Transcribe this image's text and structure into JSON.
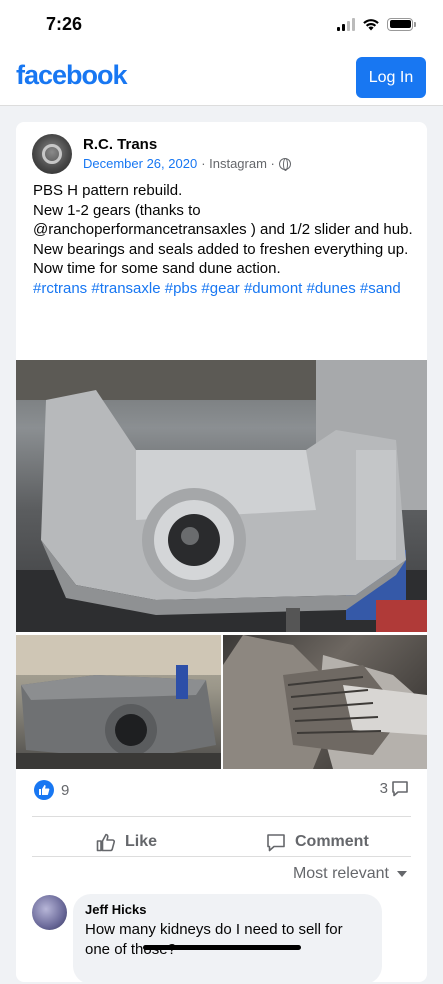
{
  "status_bar": {
    "time": "7:26"
  },
  "header": {
    "logo": "facebook",
    "login_label": "Log In"
  },
  "post": {
    "author": "R.C. Trans",
    "date": "December 26, 2020",
    "source": "· Instagram ·",
    "lines": [
      "PBS H pattern rebuild.",
      "New 1-2 gears (thanks to @ranchoperformancetransaxles ) and 1/2 slider and hub.",
      "New bearings and seals added to freshen everything up.",
      "Now time for some sand dune action."
    ],
    "hashtags": "#rctrans #transaxle #pbs #gear #dumont #dunes #sand"
  },
  "stats": {
    "likes": "9",
    "comments": "3"
  },
  "actions": {
    "like": "Like",
    "comment": "Comment"
  },
  "sort_label": "Most relevant",
  "comment": {
    "name": "Jeff Hicks",
    "text": "How many kidneys do I need to sell for one of those?"
  },
  "colors": {
    "brand": "#1877f2",
    "secondary_text": "#65676b"
  }
}
